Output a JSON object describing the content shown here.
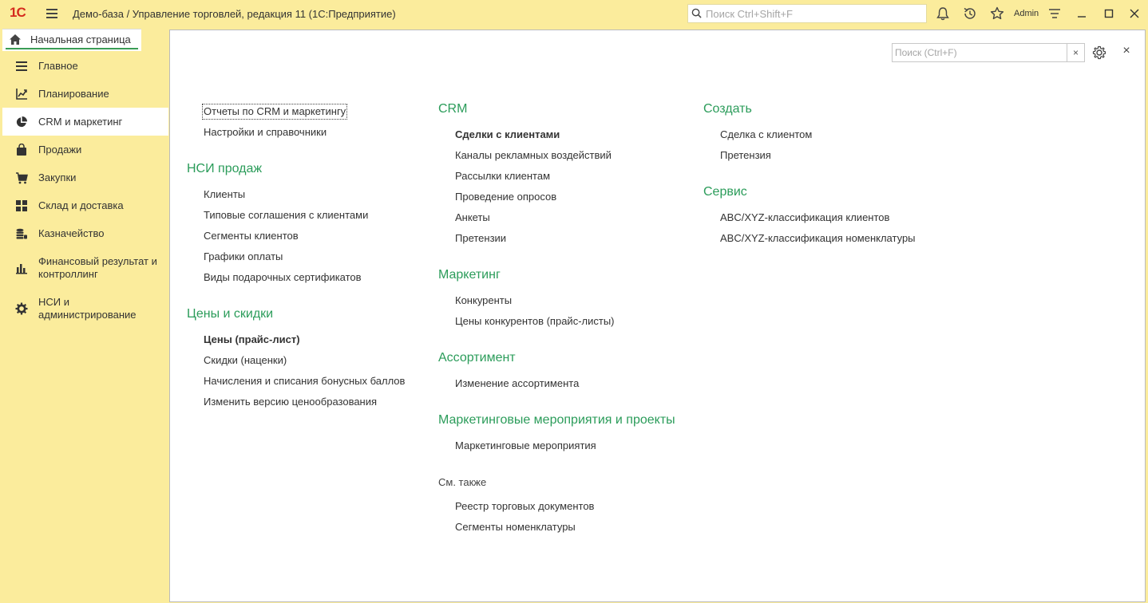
{
  "header": {
    "logo": "1С",
    "title": "Демо-база / Управление торговлей, редакция 11  (1С:Предприятие)",
    "search_placeholder": "Поиск Ctrl+Shift+F",
    "user": "Admin",
    "icons": [
      "menu-icon",
      "search-icon",
      "bell-icon",
      "history-icon",
      "star-icon",
      "settings-lines-icon",
      "minimize-icon",
      "maximize-icon",
      "close-icon"
    ]
  },
  "tab": {
    "label": "Начальная страница",
    "icon": "home-icon"
  },
  "sidebar": {
    "items": [
      {
        "label": "Главное",
        "icon": "list-icon"
      },
      {
        "label": "Планирование",
        "icon": "planning-chart-icon"
      },
      {
        "label": "CRM и маркетинг",
        "icon": "pie-chart-icon",
        "active": true
      },
      {
        "label": "Продажи",
        "icon": "bag-icon"
      },
      {
        "label": "Закупки",
        "icon": "cart-icon"
      },
      {
        "label": "Склад и доставка",
        "icon": "warehouse-grid-icon"
      },
      {
        "label": "Казначейство",
        "icon": "coins-icon"
      },
      {
        "label": "Финансовый результат и контроллинг",
        "icon": "bar-chart-icon"
      },
      {
        "label": "НСИ и администрирование",
        "icon": "gear-icon"
      }
    ]
  },
  "form": {
    "search_placeholder": "Поиск (Ctrl+F)",
    "clear_label": "×",
    "close_label": "×"
  },
  "col1": {
    "top_links": [
      "Отчеты по CRM и маркетингу",
      "Настройки и справочники"
    ],
    "nsi_title": "НСИ продаж",
    "nsi_links": [
      "Клиенты",
      "Типовые соглашения с клиентами",
      "Сегменты клиентов",
      "Графики оплаты",
      "Виды подарочных сертификатов"
    ],
    "prices_title": "Цены и скидки",
    "prices_links": [
      "Цены (прайс-лист)",
      "Скидки (наценки)",
      "Начисления и списания бонусных баллов",
      "Изменить версию ценообразования"
    ]
  },
  "col2": {
    "crm_title": "CRM",
    "crm_links": [
      "Сделки с клиентами",
      "Каналы рекламных воздействий",
      "Рассылки клиентам",
      "Проведение опросов",
      "Анкеты",
      "Претензии"
    ],
    "marketing_title": "Маркетинг",
    "marketing_links": [
      "Конкуренты",
      "Цены конкурентов (прайс-листы)"
    ],
    "assortment_title": "Ассортимент",
    "assortment_links": [
      "Изменение ассортимента"
    ],
    "events_title": "Маркетинговые мероприятия и проекты",
    "events_links": [
      "Маркетинговые мероприятия"
    ],
    "see_also_title": "См. также",
    "see_also_links": [
      "Реестр торговых документов",
      "Сегменты номенклатуры"
    ]
  },
  "col3": {
    "create_title": "Создать",
    "create_links": [
      "Сделка с клиентом",
      "Претензия"
    ],
    "service_title": "Сервис",
    "service_links": [
      "ABC/XYZ-классификация клиентов",
      "ABC/XYZ-классификация номенклатуры"
    ]
  },
  "colors": {
    "accent_green": "#2b9c5a",
    "bar_yellow": "#fbec9c",
    "logo_red": "#d52b1e"
  }
}
